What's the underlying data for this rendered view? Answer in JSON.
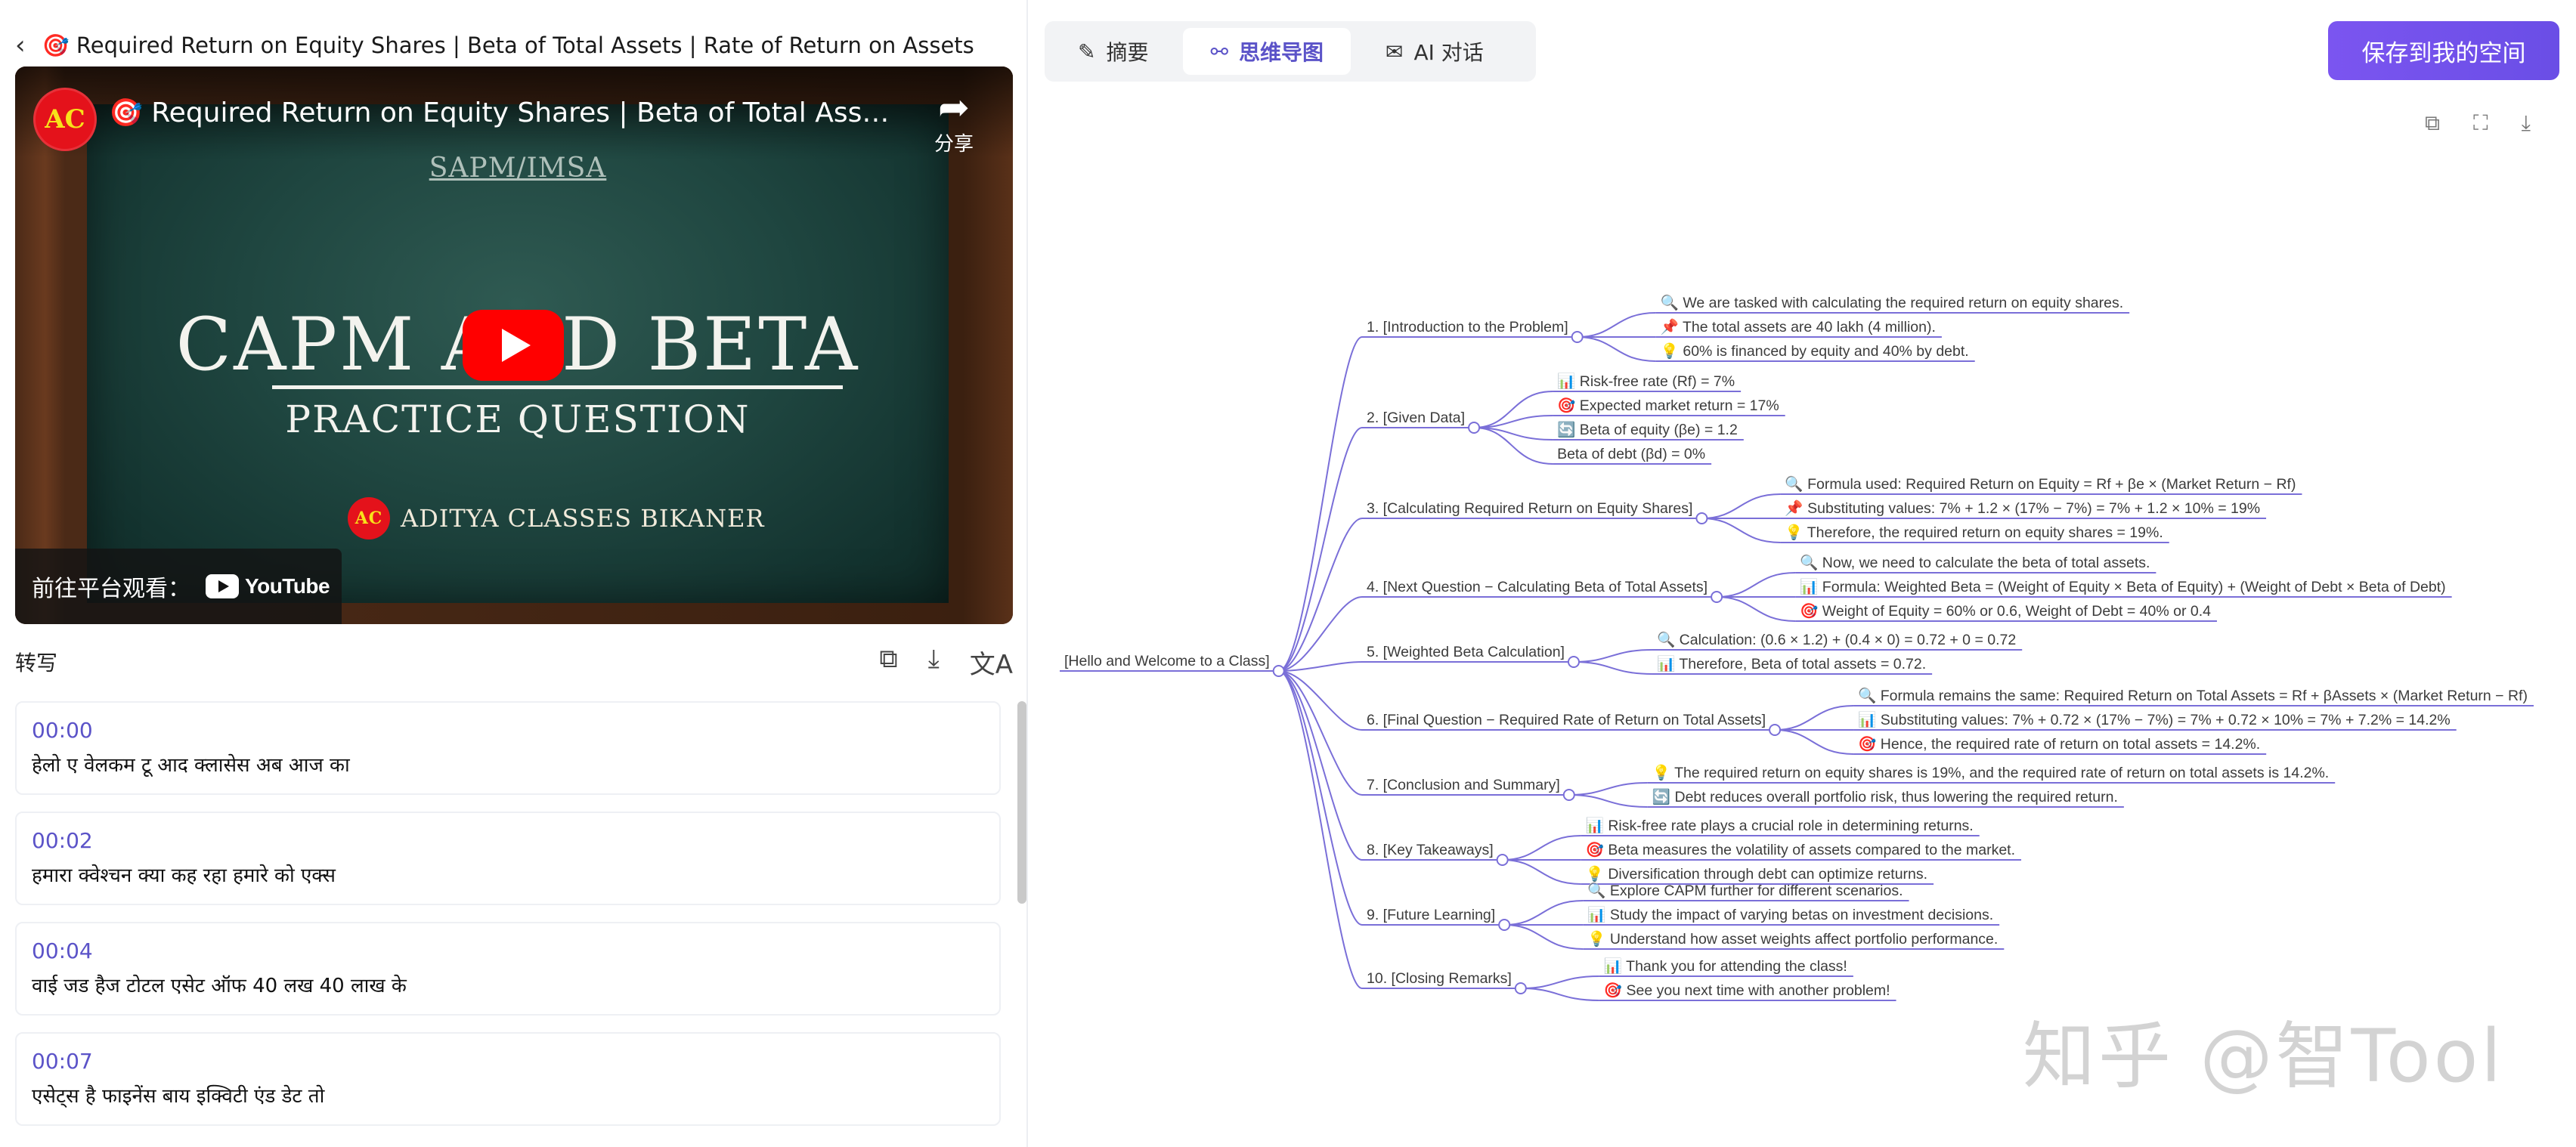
{
  "video_header": {
    "back_icon": "‹",
    "title": "🎯 Required Return on Equity Shares | Beta of Total Assets | Rate of Return on Assets"
  },
  "player": {
    "title": "🎯 Required Return on Equity Shares | Beta of Total Assets | Rat...",
    "channel_logo_text": "AC",
    "share_label": "分享",
    "board_header": "SAPM/IMSA",
    "board_title": "CAPM AND BETA",
    "board_subtitle": "PRACTICE QUESTION",
    "brand_name": "ADITYA CLASSES BIKANER",
    "watch_on_label": "前往平台观看：",
    "youtube_label": "YouTube"
  },
  "transcript": {
    "label": "转写",
    "segments": [
      {
        "time": "00:00",
        "text": "हेलो ए वेलकम टू आद क्लासेस अब आज का"
      },
      {
        "time": "00:02",
        "text": "हमारा क्वेश्चन क्या कह रहा हमारे को एक्स"
      },
      {
        "time": "00:04",
        "text": "वाई जड हैज टोटल एसेट ऑफ 40 लख 40 लाख के"
      },
      {
        "time": "00:07",
        "text": "एसेट्स है फाइनेंस बाय इक्विटी एंड डेट तो"
      }
    ]
  },
  "tabs": [
    {
      "icon": "✎",
      "label": "摘要"
    },
    {
      "icon": "⚯",
      "label": "思维导图"
    },
    {
      "icon": "✉",
      "label": "AI 对话"
    }
  ],
  "save_button": "保存到我的空间",
  "map_tools": {
    "copy": "⧉",
    "fullscreen": "⛶",
    "download": "⤓"
  },
  "mindmap": {
    "root": "[Hello and Welcome to a Class]",
    "branches": [
      {
        "label": "1. [Introduction to the Problem]",
        "children": [
          "🔍 We are tasked with calculating the required return on equity shares.",
          "📌 The total assets are 40 lakh (4 million).",
          "💡 60% is financed by equity and 40% by debt."
        ]
      },
      {
        "label": "2. [Given Data]",
        "children": [
          "📊 Risk-free rate (Rf) = 7%",
          "🎯 Expected market return = 17%",
          "🔄 Beta of equity (βe) = 1.2",
          "Beta of debt (βd) = 0%"
        ]
      },
      {
        "label": "3. [Calculating Required Return on Equity Shares]",
        "children": [
          "🔍 Formula used: Required Return on Equity = Rf + βe × (Market Return − Rf)",
          "📌 Substituting values: 7% + 1.2 × (17% − 7%) = 7% + 1.2 × 10% = 19%",
          "💡 Therefore, the required return on equity shares = 19%."
        ]
      },
      {
        "label": "4. [Next Question − Calculating Beta of Total Assets]",
        "children": [
          "🔍 Now, we need to calculate the beta of total assets.",
          "📊 Formula: Weighted Beta = (Weight of Equity × Beta of Equity) + (Weight of Debt × Beta of Debt)",
          "🎯 Weight of Equity = 60% or 0.6, Weight of Debt = 40% or 0.4"
        ]
      },
      {
        "label": "5. [Weighted Beta Calculation]",
        "children": [
          "🔍 Calculation: (0.6 × 1.2) + (0.4 × 0) = 0.72 + 0 = 0.72",
          "📊 Therefore, Beta of total assets = 0.72."
        ]
      },
      {
        "label": "6. [Final Question − Required Rate of Return on Total Assets]",
        "children": [
          "🔍 Formula remains the same: Required Return on Total Assets = Rf + βAssets × (Market Return − Rf)",
          "📊 Substituting values: 7% + 0.72 × (17% − 7%) = 7% + 0.72 × 10% = 7% + 7.2% = 14.2%",
          "🎯 Hence, the required rate of return on total assets = 14.2%."
        ]
      },
      {
        "label": "7. [Conclusion and Summary]",
        "children": [
          "💡 The required return on equity shares is 19%, and the required rate of return on total assets is 14.2%.",
          "🔄 Debt reduces overall portfolio risk, thus lowering the required return."
        ]
      },
      {
        "label": "8. [Key Takeaways]",
        "children": [
          "📊 Risk-free rate plays a crucial role in determining returns.",
          "🎯 Beta measures the volatility of assets compared to the market.",
          "💡 Diversification through debt can optimize returns."
        ]
      },
      {
        "label": "9. [Future Learning]",
        "children": [
          "🔍 Explore CAPM further for different scenarios.",
          "📊 Study the impact of varying betas on investment decisions.",
          "💡 Understand how asset weights affect portfolio performance."
        ]
      },
      {
        "label": "10. [Closing Remarks]",
        "children": [
          "📊 Thank you for attending the class!",
          "🎯 See you next time with another problem!"
        ]
      }
    ]
  },
  "colors": {
    "accent": "#5b53c8",
    "line": "#7a6fd8",
    "save_start": "#7b55f0",
    "save_end": "#6a4ee6",
    "yt_red": "#ff0000"
  },
  "watermark": "知乎 @智Tool"
}
